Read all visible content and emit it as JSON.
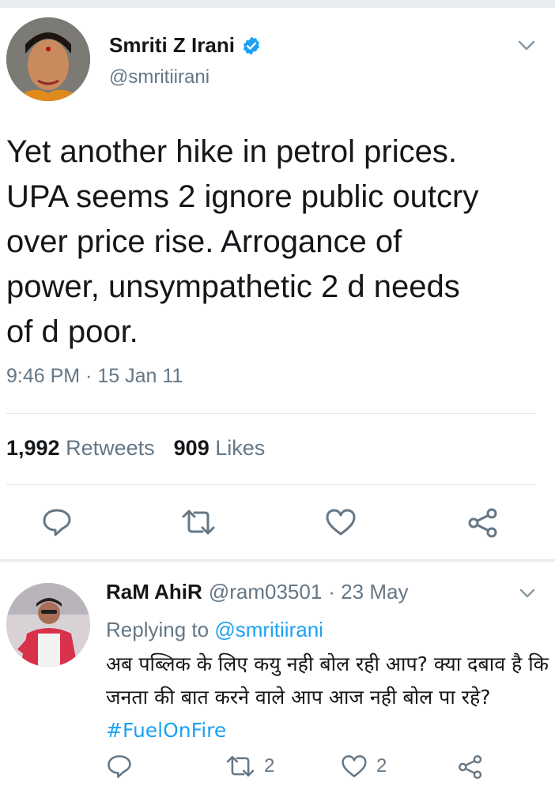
{
  "tweet": {
    "author_name": "Smriti Z Irani",
    "handle": "@smritiirani",
    "text": "Yet another hike in petrol prices.\nUPA seems 2 ignore public outcry\nover price rise. Arrogance of\npower, unsympathetic 2 d needs\nof d poor.",
    "timestamp": "9:46 PM · 15 Jan 11",
    "retweets_count": "1,992",
    "retweets_label": "Retweets",
    "likes_count": "909",
    "likes_label": "Likes"
  },
  "reply": {
    "author_name": "RaM AhiR",
    "handle": "@ram03501",
    "date": "· 23 May",
    "replying_prefix": "Replying to",
    "replying_handle": "@smritiirani",
    "text": "अब पब्लिक के लिए कयु नही बोल रही आप? क्या दबाव है कि जनता की बात करने वाले आप आज नही बोल पा रहे?",
    "hashtag": "#FuelOnFire",
    "retweets_count": "2",
    "likes_count": "2"
  },
  "colors": {
    "accent": "#1da1f2",
    "secondary_text": "#657786",
    "icon": "#657786"
  }
}
